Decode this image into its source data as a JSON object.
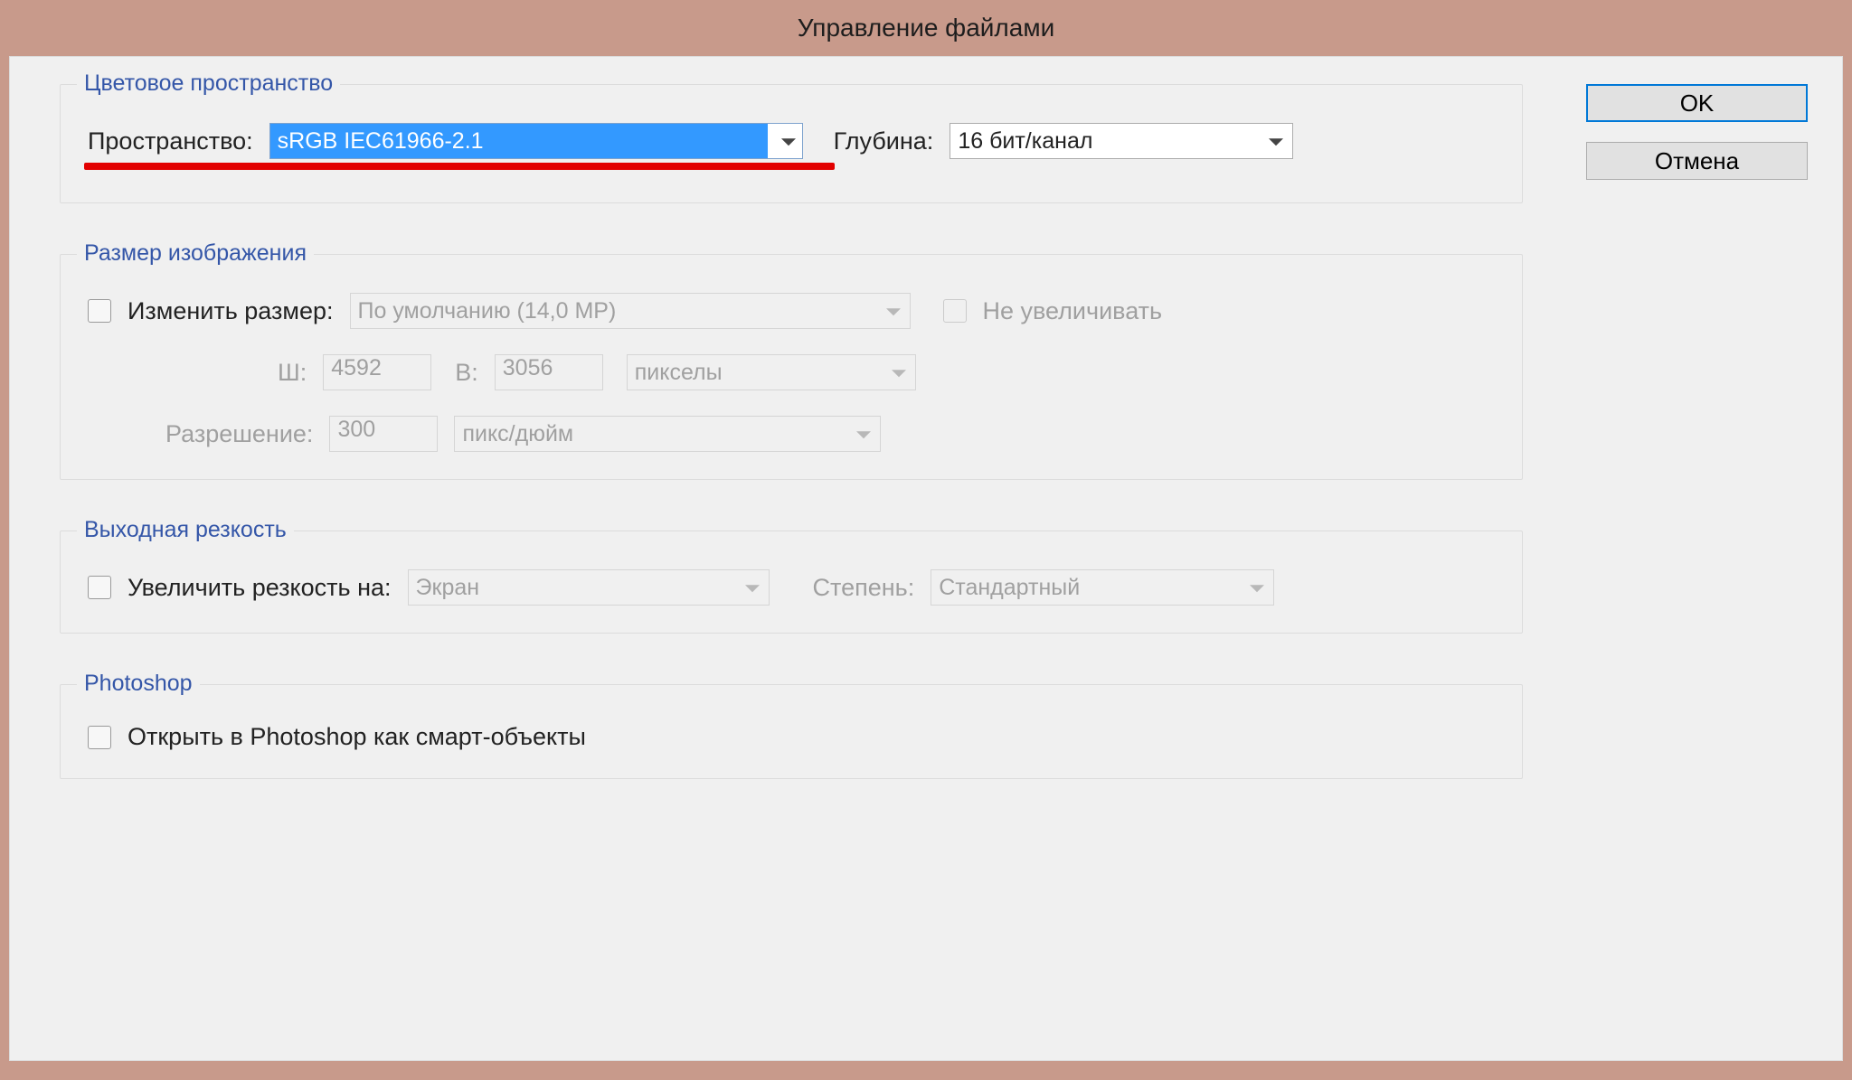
{
  "window": {
    "title": "Управление файлами"
  },
  "buttons": {
    "ok": "OK",
    "cancel": "Отмена"
  },
  "color_space": {
    "legend": "Цветовое пространство",
    "space_label": "Пространство:",
    "space_value": "sRGB IEC61966-2.1",
    "depth_label": "Глубина:",
    "depth_value": "16 бит/канал"
  },
  "image_size": {
    "legend": "Размер изображения",
    "resize_label": "Изменить размер:",
    "preset_value": "По умолчанию (14,0 MP)",
    "no_enlarge_label": "Не увеличивать",
    "w_label": "Ш:",
    "w_value": "4592",
    "h_label": "В:",
    "h_value": "3056",
    "unit_value": "пикселы",
    "res_label": "Разрешение:",
    "res_value": "300",
    "res_unit_value": "пикс/дюйм"
  },
  "sharpening": {
    "legend": "Выходная резкость",
    "enable_label": "Увеличить резкость на:",
    "target_value": "Экран",
    "amount_label": "Степень:",
    "amount_value": "Стандартный"
  },
  "photoshop": {
    "legend": "Photoshop",
    "smart_label": "Открыть в Photoshop как смарт-объекты"
  }
}
